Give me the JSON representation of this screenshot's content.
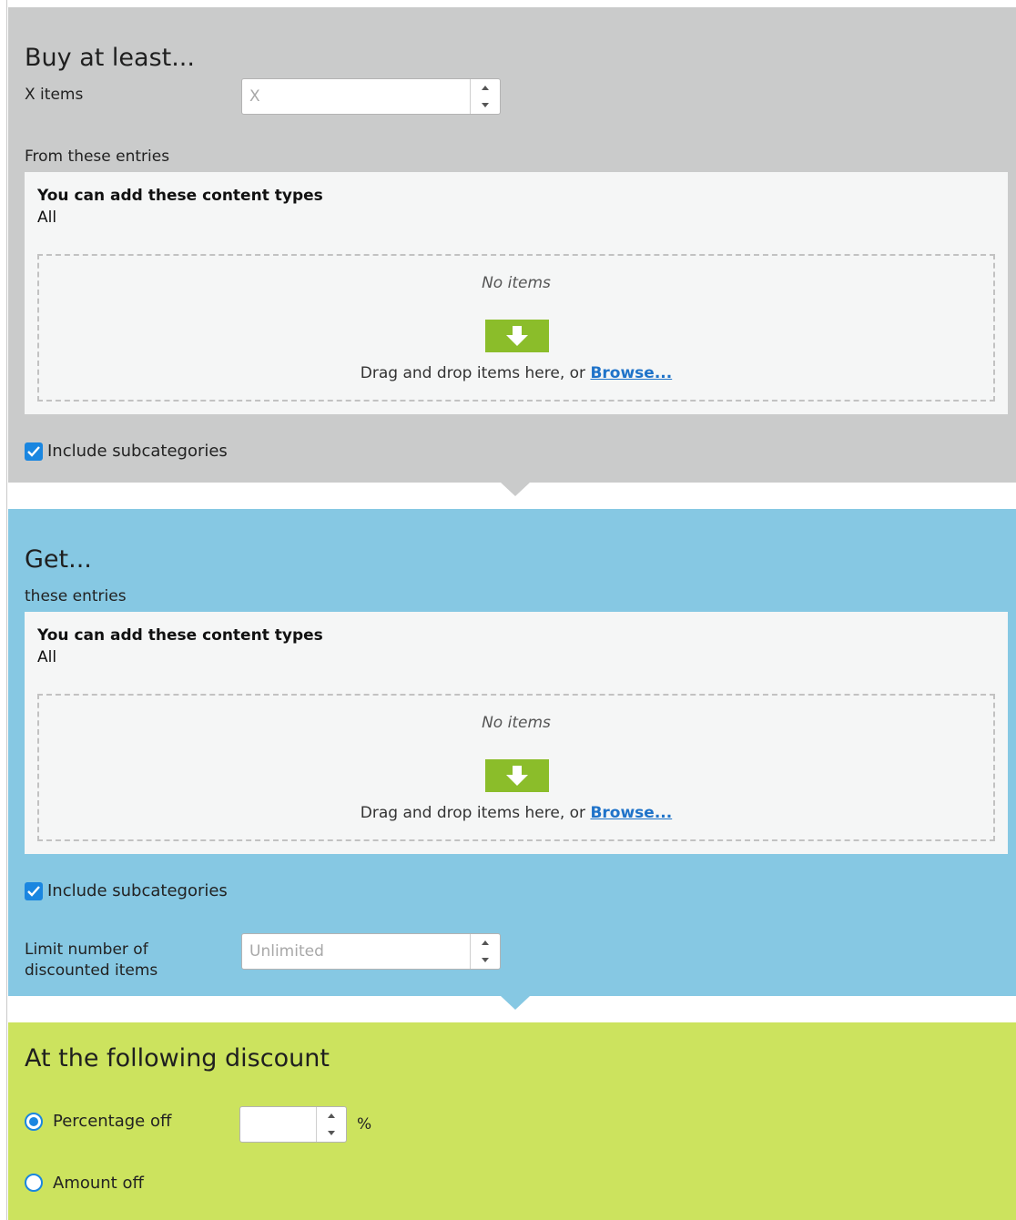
{
  "buy_section": {
    "heading": "Buy at least...",
    "x_items_label": "X items",
    "x_items_placeholder": "X",
    "x_items_value": "",
    "entries_label": "From these entries",
    "content_types_title": "You can add these content types",
    "content_types_value": "All",
    "no_items_text": "No items",
    "drop_text": "Drag and drop items here, or ",
    "browse_label": "Browse...",
    "include_subcategories_label": "Include subcategories",
    "include_subcategories_checked": true
  },
  "get_section": {
    "heading": "Get...",
    "entries_label": "these entries",
    "content_types_title": "You can add these content types",
    "content_types_value": "All",
    "no_items_text": "No items",
    "drop_text": "Drag and drop items here, or ",
    "browse_label": "Browse...",
    "include_subcategories_label": "Include subcategories",
    "include_subcategories_checked": true,
    "limit_label_line1": "Limit number of",
    "limit_label_line2": "discounted items",
    "limit_placeholder": "Unlimited",
    "limit_value": ""
  },
  "discount_section": {
    "heading": "At the following discount",
    "options": [
      {
        "label": "Percentage off",
        "selected": true
      },
      {
        "label": "Amount off",
        "selected": false
      }
    ],
    "percentage_value": "",
    "percent_symbol": "%"
  },
  "colors": {
    "buy_bg": "#cacbcb",
    "get_bg": "#86c8e3",
    "discount_bg": "#cce35e",
    "accent_blue": "#1a86e0",
    "drop_green": "#8bbd2a",
    "link_blue": "#1f73c9"
  },
  "icons": {
    "spin_up": "triangle-up-icon",
    "spin_down": "triangle-down-icon",
    "drop": "arrow-down-icon",
    "check": "checkmark-icon"
  }
}
